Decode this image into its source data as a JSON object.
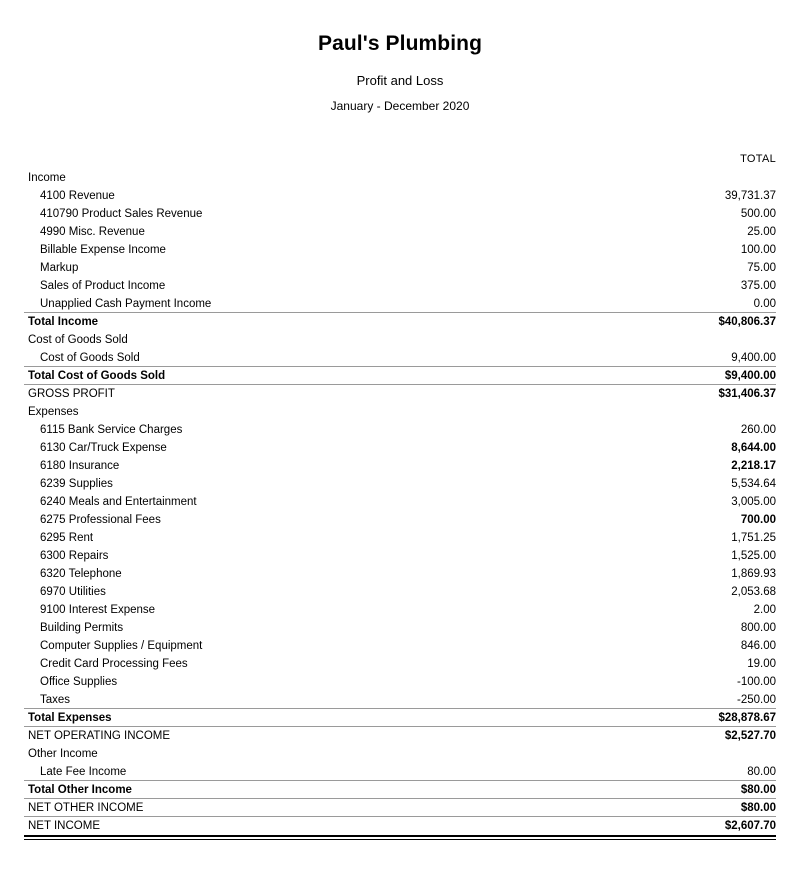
{
  "report": {
    "company": "Paul's Plumbing",
    "title": "Profit and Loss",
    "period": "January - December 2020",
    "total_column_header": "TOTAL"
  },
  "rows": [
    {
      "label": "Income",
      "value": "",
      "level": 0,
      "bold": false,
      "value_bold": false,
      "rule": "none"
    },
    {
      "label": "4100 Revenue",
      "value": "39,731.37",
      "level": 1,
      "bold": false,
      "value_bold": false,
      "rule": "none"
    },
    {
      "label": "410790 Product Sales Revenue",
      "value": "500.00",
      "level": 1,
      "bold": false,
      "value_bold": false,
      "rule": "none"
    },
    {
      "label": "4990 Misc. Revenue",
      "value": "25.00",
      "level": 1,
      "bold": false,
      "value_bold": false,
      "rule": "none"
    },
    {
      "label": "Billable Expense Income",
      "value": "100.00",
      "level": 1,
      "bold": false,
      "value_bold": false,
      "rule": "none"
    },
    {
      "label": "Markup",
      "value": "75.00",
      "level": 1,
      "bold": false,
      "value_bold": false,
      "rule": "none"
    },
    {
      "label": "Sales of Product Income",
      "value": "375.00",
      "level": 1,
      "bold": false,
      "value_bold": false,
      "rule": "none"
    },
    {
      "label": "Unapplied Cash Payment Income",
      "value": "0.00",
      "level": 1,
      "bold": false,
      "value_bold": false,
      "rule": "none"
    },
    {
      "label": "Total Income",
      "value": "$40,806.37",
      "level": 0,
      "bold": true,
      "value_bold": true,
      "rule": "top-thin"
    },
    {
      "label": "Cost of Goods Sold",
      "value": "",
      "level": 0,
      "bold": false,
      "value_bold": false,
      "rule": "none"
    },
    {
      "label": "Cost of Goods Sold",
      "value": "9,400.00",
      "level": 1,
      "bold": false,
      "value_bold": false,
      "rule": "none"
    },
    {
      "label": "Total Cost of Goods Sold",
      "value": "$9,400.00",
      "level": 0,
      "bold": true,
      "value_bold": true,
      "rule": "top-thin"
    },
    {
      "label": "GROSS PROFIT",
      "value": "$31,406.37",
      "level": 0,
      "bold": false,
      "value_bold": true,
      "rule": "top-thin"
    },
    {
      "label": "Expenses",
      "value": "",
      "level": 0,
      "bold": false,
      "value_bold": false,
      "rule": "none"
    },
    {
      "label": "6115 Bank Service Charges",
      "value": "260.00",
      "level": 1,
      "bold": false,
      "value_bold": false,
      "rule": "none"
    },
    {
      "label": "6130 Car/Truck Expense",
      "value": "8,644.00",
      "level": 1,
      "bold": false,
      "value_bold": true,
      "rule": "none"
    },
    {
      "label": "6180 Insurance",
      "value": "2,218.17",
      "level": 1,
      "bold": false,
      "value_bold": true,
      "rule": "none"
    },
    {
      "label": "6239 Supplies",
      "value": "5,534.64",
      "level": 1,
      "bold": false,
      "value_bold": false,
      "rule": "none"
    },
    {
      "label": "6240 Meals and Entertainment",
      "value": "3,005.00",
      "level": 1,
      "bold": false,
      "value_bold": false,
      "rule": "none"
    },
    {
      "label": "6275 Professional Fees",
      "value": "700.00",
      "level": 1,
      "bold": false,
      "value_bold": true,
      "rule": "none"
    },
    {
      "label": "6295 Rent",
      "value": "1,751.25",
      "level": 1,
      "bold": false,
      "value_bold": false,
      "rule": "none"
    },
    {
      "label": "6300 Repairs",
      "value": "1,525.00",
      "level": 1,
      "bold": false,
      "value_bold": false,
      "rule": "none"
    },
    {
      "label": "6320 Telephone",
      "value": "1,869.93",
      "level": 1,
      "bold": false,
      "value_bold": false,
      "rule": "none"
    },
    {
      "label": "6970 Utilities",
      "value": "2,053.68",
      "level": 1,
      "bold": false,
      "value_bold": false,
      "rule": "none"
    },
    {
      "label": "9100 Interest Expense",
      "value": "2.00",
      "level": 1,
      "bold": false,
      "value_bold": false,
      "rule": "none"
    },
    {
      "label": "Building Permits",
      "value": "800.00",
      "level": 1,
      "bold": false,
      "value_bold": false,
      "rule": "none"
    },
    {
      "label": "Computer Supplies / Equipment",
      "value": "846.00",
      "level": 1,
      "bold": false,
      "value_bold": false,
      "rule": "none"
    },
    {
      "label": "Credit Card Processing Fees",
      "value": "19.00",
      "level": 1,
      "bold": false,
      "value_bold": false,
      "rule": "none"
    },
    {
      "label": "Office Supplies",
      "value": "-100.00",
      "level": 1,
      "bold": false,
      "value_bold": false,
      "rule": "none"
    },
    {
      "label": "Taxes",
      "value": "-250.00",
      "level": 1,
      "bold": false,
      "value_bold": false,
      "rule": "none"
    },
    {
      "label": "Total Expenses",
      "value": "$28,878.67",
      "level": 0,
      "bold": true,
      "value_bold": true,
      "rule": "top-thin"
    },
    {
      "label": "NET OPERATING INCOME",
      "value": "$2,527.70",
      "level": 0,
      "bold": false,
      "value_bold": true,
      "rule": "top-thin"
    },
    {
      "label": "Other Income",
      "value": "",
      "level": 0,
      "bold": false,
      "value_bold": false,
      "rule": "none"
    },
    {
      "label": "Late Fee Income",
      "value": "80.00",
      "level": 1,
      "bold": false,
      "value_bold": false,
      "rule": "none"
    },
    {
      "label": "Total Other Income",
      "value": "$80.00",
      "level": 0,
      "bold": true,
      "value_bold": true,
      "rule": "top-thin"
    },
    {
      "label": "NET OTHER INCOME",
      "value": "$80.00",
      "level": 0,
      "bold": false,
      "value_bold": true,
      "rule": "top-thin"
    },
    {
      "label": "NET INCOME",
      "value": "$2,607.70",
      "level": 0,
      "bold": false,
      "value_bold": true,
      "rule": "top-thin"
    }
  ]
}
